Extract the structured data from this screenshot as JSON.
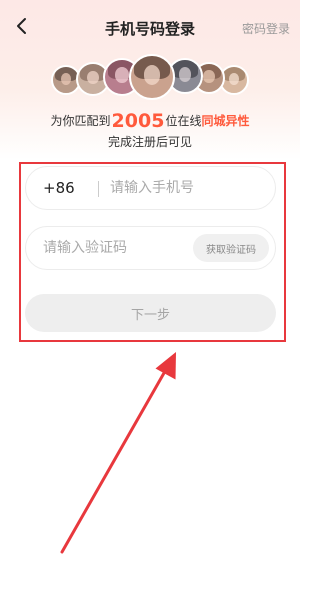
{
  "header": {
    "title": "手机号码登录",
    "password_login": "密码登录",
    "back_icon": "chevron-left-icon"
  },
  "banner": {
    "match_prefix": "为你匹配到",
    "match_count": "2005",
    "match_middle": "位在线",
    "match_highlight": "同城异性",
    "match_sub": "完成注册后可见",
    "highlight_color": "#ff5a3c"
  },
  "form": {
    "country_code": "+86",
    "phone_placeholder": "请输入手机号",
    "phone_value": "",
    "code_placeholder": "请输入验证码",
    "code_value": "",
    "get_code_label": "获取验证码",
    "next_label": "下一步"
  },
  "annotation": {
    "box_color": "#e8383d",
    "arrow_color": "#e8383d"
  }
}
